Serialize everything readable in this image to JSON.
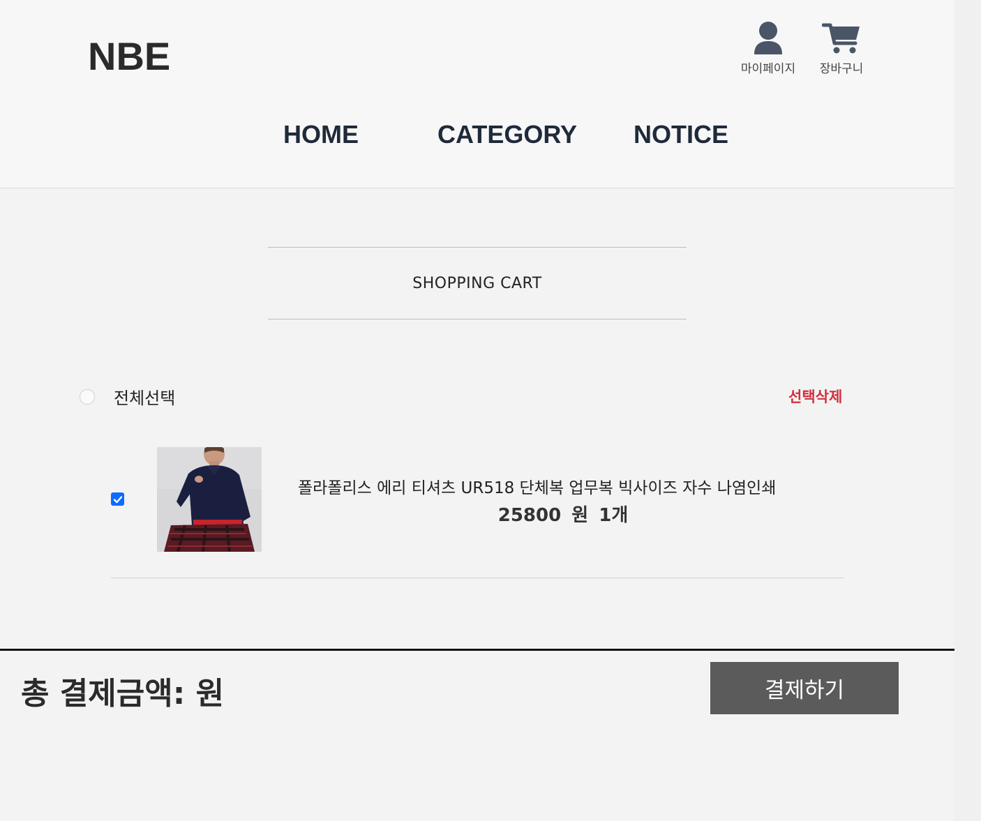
{
  "header": {
    "logo": "NBE",
    "utilities": {
      "mypage_label": "마이페이지",
      "cart_label": "장바구니",
      "icon_color": "#4a5568"
    },
    "nav": {
      "home": "HOME",
      "category": "CATEGORY",
      "notice": "NOTICE"
    }
  },
  "cart": {
    "title": "SHOPPING CART",
    "select_all_label": "전체선택",
    "delete_selected_label": "선택삭제",
    "items": [
      {
        "name": "폴라폴리스 에리 티셔츠 UR518 단체복 업무복 빅사이즈 자수 나염인쇄",
        "price": "25800",
        "currency": "원",
        "quantity": "1개",
        "checked": true,
        "image_icon": "polo-shirt-photo"
      }
    ]
  },
  "summary": {
    "total_label": "총 결제금액: 원",
    "pay_button": "결제하기"
  },
  "colors": {
    "accent_delete": "#d0303f",
    "checkbox": "#0a6cff",
    "pay_button_bg": "#5b5b5b",
    "nav_text": "#1f2a3a"
  }
}
